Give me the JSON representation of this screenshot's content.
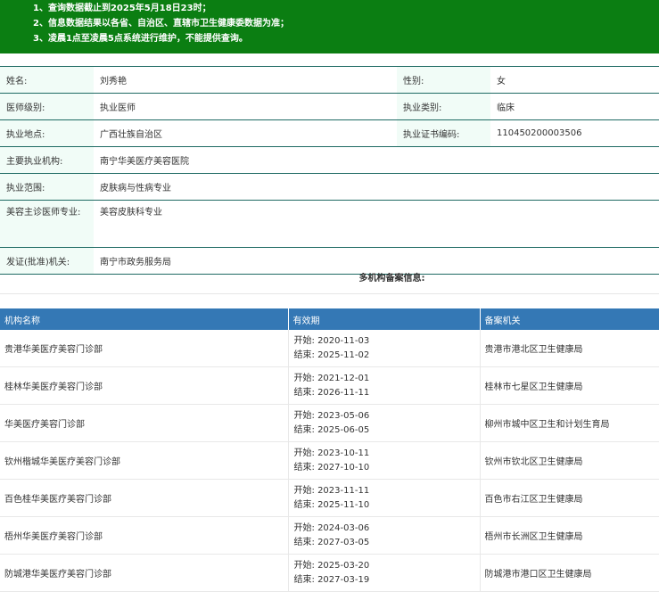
{
  "notice": {
    "lines": [
      "1、查询数据截止到2025年5月18日23时；",
      "2、信息数据结果以各省、自治区、直辖市卫生健康委数据为准；",
      "3、凌晨1点至凌晨5点系统进行维护，不能提供查询。"
    ]
  },
  "info": {
    "name_label": "姓名:",
    "name": "刘秀艳",
    "gender_label": "性别:",
    "gender": "女",
    "level_label": "医师级别:",
    "level": "执业医师",
    "category_label": "执业类别:",
    "category": "临床",
    "location_label": "执业地点:",
    "location": "广西壮族自治区",
    "cert_label": "执业证书编码:",
    "cert": "110450200003506",
    "institution_label": "主要执业机构:",
    "institution": "南宁华美医疗美容医院",
    "scope_label": "执业范围:",
    "scope": "皮肤病与性病专业",
    "cosmetic_label": "美容主诊医师专业:",
    "cosmetic": "美容皮肤科专业",
    "issuer_label": "发证(批准)机关:",
    "issuer": "南宁市政务服务局"
  },
  "multi_title": "多机构备案信息:",
  "orgs": {
    "headers": [
      "机构名称",
      "有效期",
      "备案机关"
    ],
    "start_prefix": "开始:",
    "end_prefix": "结束:",
    "rows": [
      {
        "name": "贵港华美医疗美容门诊部",
        "start": "2020-11-03",
        "end": "2025-11-02",
        "authority": "贵港市港北区卫生健康局"
      },
      {
        "name": "桂林华美医疗美容门诊部",
        "start": "2021-12-01",
        "end": "2026-11-11",
        "authority": "桂林市七星区卫生健康局"
      },
      {
        "name": "华美医疗美容门诊部",
        "start": "2023-05-06",
        "end": "2025-06-05",
        "authority": "柳州市城中区卫生和计划生育局"
      },
      {
        "name": "钦州楷城华美医疗美容门诊部",
        "start": "2023-10-11",
        "end": "2027-10-10",
        "authority": "钦州市钦北区卫生健康局"
      },
      {
        "name": "百色桂华美医疗美容门诊部",
        "start": "2023-11-11",
        "end": "2025-11-10",
        "authority": "百色市右江区卫生健康局"
      },
      {
        "name": "梧州华美医疗美容门诊部",
        "start": "2024-03-06",
        "end": "2027-03-05",
        "authority": "梧州市长洲区卫生健康局"
      },
      {
        "name": "防城港华美医疗美容门诊部",
        "start": "2025-03-20",
        "end": "2027-03-19",
        "authority": "防城港市港口区卫生健康局"
      }
    ]
  }
}
